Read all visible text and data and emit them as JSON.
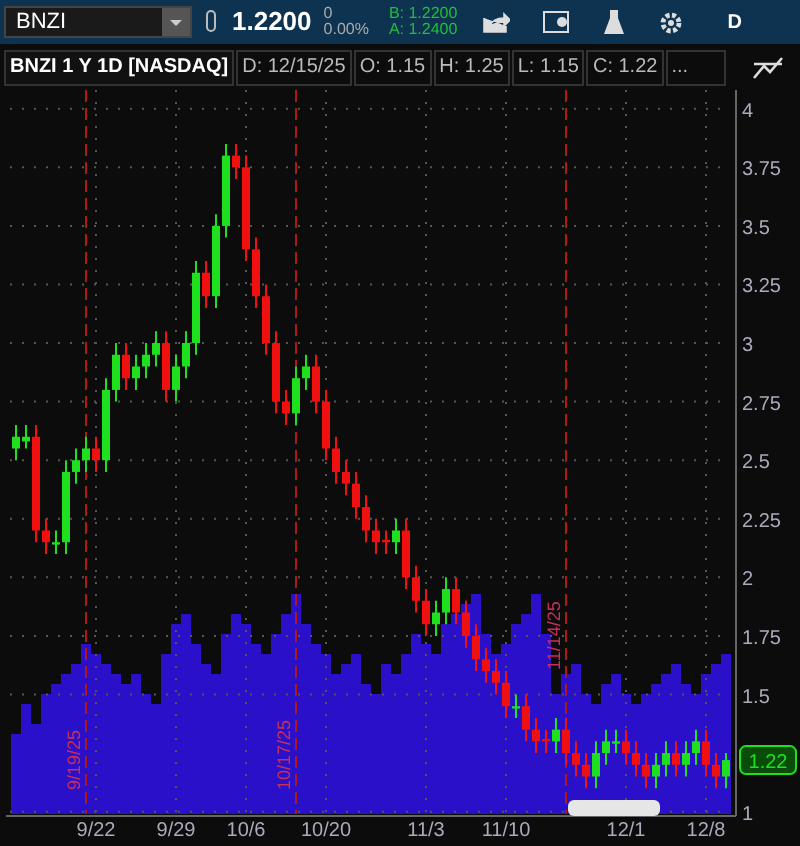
{
  "toolbar": {
    "symbol": "BNZI",
    "last": "1.2200",
    "change": "0",
    "change_percent": "0.00%",
    "bid": "B: 1.2200",
    "ask": "A: 1.2400",
    "period_button": "D"
  },
  "info_bar": {
    "title": "BNZI 1 Y 1D [NASDAQ]",
    "fields": [
      "D: 12/15/25",
      "O: 1.15",
      "H: 1.25",
      "L: 1.15",
      "C: 1.22"
    ],
    "more": "..."
  },
  "price_label": "1.22",
  "chart_data": {
    "type": "candlestick",
    "grid": true,
    "ylim": [
      0.99,
      4.08
    ],
    "yticks": [
      1,
      1.5,
      1.75,
      2,
      2.25,
      2.5,
      2.75,
      3,
      3.25,
      3.5,
      3.75,
      4
    ],
    "annotations": [
      "9/19/25",
      "10/17/25",
      "11/14/25"
    ],
    "categories": [
      null,
      null,
      null,
      null,
      null,
      null,
      null,
      null,
      "9/22",
      null,
      null,
      null,
      null,
      null,
      null,
      null,
      "9/29",
      null,
      null,
      null,
      null,
      null,
      null,
      "10/6",
      null,
      null,
      null,
      null,
      null,
      null,
      null,
      "10/20",
      null,
      null,
      null,
      null,
      null,
      null,
      null,
      null,
      null,
      "11/3",
      null,
      null,
      null,
      null,
      null,
      null,
      null,
      "11/10",
      null,
      null,
      null,
      null,
      null,
      null,
      null,
      null,
      null,
      null,
      null,
      "12/1",
      null,
      null,
      null,
      null,
      null,
      null,
      null,
      "12/8",
      null,
      null
    ],
    "ohlc": [
      [
        2.55,
        2.65,
        2.5,
        2.6
      ],
      [
        2.58,
        2.65,
        2.55,
        2.6
      ],
      [
        2.6,
        2.65,
        2.15,
        2.2
      ],
      [
        2.2,
        2.25,
        2.1,
        2.15
      ],
      [
        2.14,
        2.2,
        2.1,
        2.15
      ],
      [
        2.15,
        2.5,
        2.1,
        2.45
      ],
      [
        2.45,
        2.55,
        2.4,
        2.5
      ],
      [
        2.5,
        2.6,
        2.45,
        2.55
      ],
      [
        2.55,
        2.6,
        2.45,
        2.5
      ],
      [
        2.5,
        2.85,
        2.45,
        2.8
      ],
      [
        2.8,
        3.0,
        2.75,
        2.95
      ],
      [
        2.95,
        3.0,
        2.8,
        2.85
      ],
      [
        2.85,
        2.95,
        2.8,
        2.9
      ],
      [
        2.9,
        3.0,
        2.85,
        2.95
      ],
      [
        2.95,
        3.05,
        2.9,
        3.0
      ],
      [
        3.0,
        3.05,
        2.75,
        2.8
      ],
      [
        2.8,
        2.95,
        2.75,
        2.9
      ],
      [
        2.9,
        3.05,
        2.85,
        3.0
      ],
      [
        3.0,
        3.35,
        2.95,
        3.3
      ],
      [
        3.3,
        3.35,
        3.15,
        3.2
      ],
      [
        3.2,
        3.55,
        3.15,
        3.5
      ],
      [
        3.5,
        3.85,
        3.45,
        3.8
      ],
      [
        3.8,
        3.85,
        3.7,
        3.75
      ],
      [
        3.75,
        3.8,
        3.35,
        3.4
      ],
      [
        3.4,
        3.45,
        3.15,
        3.2
      ],
      [
        3.2,
        3.25,
        2.95,
        3.0
      ],
      [
        3.0,
        3.05,
        2.7,
        2.75
      ],
      [
        2.75,
        2.8,
        2.65,
        2.7
      ],
      [
        2.7,
        2.9,
        2.65,
        2.85
      ],
      [
        2.85,
        2.95,
        2.8,
        2.9
      ],
      [
        2.9,
        2.95,
        2.7,
        2.75
      ],
      [
        2.75,
        2.8,
        2.5,
        2.55
      ],
      [
        2.55,
        2.6,
        2.4,
        2.45
      ],
      [
        2.45,
        2.5,
        2.35,
        2.4
      ],
      [
        2.4,
        2.45,
        2.25,
        2.3
      ],
      [
        2.3,
        2.35,
        2.15,
        2.2
      ],
      [
        2.2,
        2.25,
        2.1,
        2.15
      ],
      [
        2.16,
        2.2,
        2.1,
        2.15
      ],
      [
        2.15,
        2.25,
        2.1,
        2.2
      ],
      [
        2.2,
        2.25,
        1.95,
        2.0
      ],
      [
        2.0,
        2.05,
        1.85,
        1.9
      ],
      [
        1.9,
        1.95,
        1.75,
        1.8
      ],
      [
        1.8,
        1.9,
        1.75,
        1.85
      ],
      [
        1.85,
        2.0,
        1.8,
        1.95
      ],
      [
        1.95,
        2.0,
        1.8,
        1.85
      ],
      [
        1.85,
        1.9,
        1.7,
        1.75
      ],
      [
        1.75,
        1.8,
        1.6,
        1.65
      ],
      [
        1.65,
        1.7,
        1.55,
        1.6
      ],
      [
        1.6,
        1.65,
        1.5,
        1.55
      ],
      [
        1.55,
        1.6,
        1.4,
        1.45
      ],
      [
        1.44,
        1.5,
        1.4,
        1.45
      ],
      [
        1.45,
        1.5,
        1.3,
        1.35
      ],
      [
        1.35,
        1.4,
        1.25,
        1.3
      ],
      [
        1.31,
        1.35,
        1.25,
        1.3
      ],
      [
        1.3,
        1.4,
        1.25,
        1.35
      ],
      [
        1.35,
        1.4,
        1.2,
        1.25
      ],
      [
        1.25,
        1.3,
        1.15,
        1.2
      ],
      [
        1.2,
        1.25,
        1.1,
        1.15
      ],
      [
        1.15,
        1.3,
        1.1,
        1.25
      ],
      [
        1.25,
        1.35,
        1.2,
        1.3
      ],
      [
        1.29,
        1.35,
        1.25,
        1.3
      ],
      [
        1.3,
        1.35,
        1.2,
        1.25
      ],
      [
        1.25,
        1.3,
        1.15,
        1.2
      ],
      [
        1.2,
        1.25,
        1.1,
        1.15
      ],
      [
        1.15,
        1.25,
        1.1,
        1.2
      ],
      [
        1.2,
        1.3,
        1.15,
        1.25
      ],
      [
        1.25,
        1.3,
        1.15,
        1.2
      ],
      [
        1.2,
        1.3,
        1.15,
        1.25
      ],
      [
        1.25,
        1.35,
        1.2,
        1.3
      ],
      [
        1.3,
        1.35,
        1.15,
        1.2
      ],
      [
        1.2,
        1.25,
        1.1,
        1.15
      ],
      [
        1.15,
        1.25,
        1.1,
        1.22
      ]
    ]
  }
}
